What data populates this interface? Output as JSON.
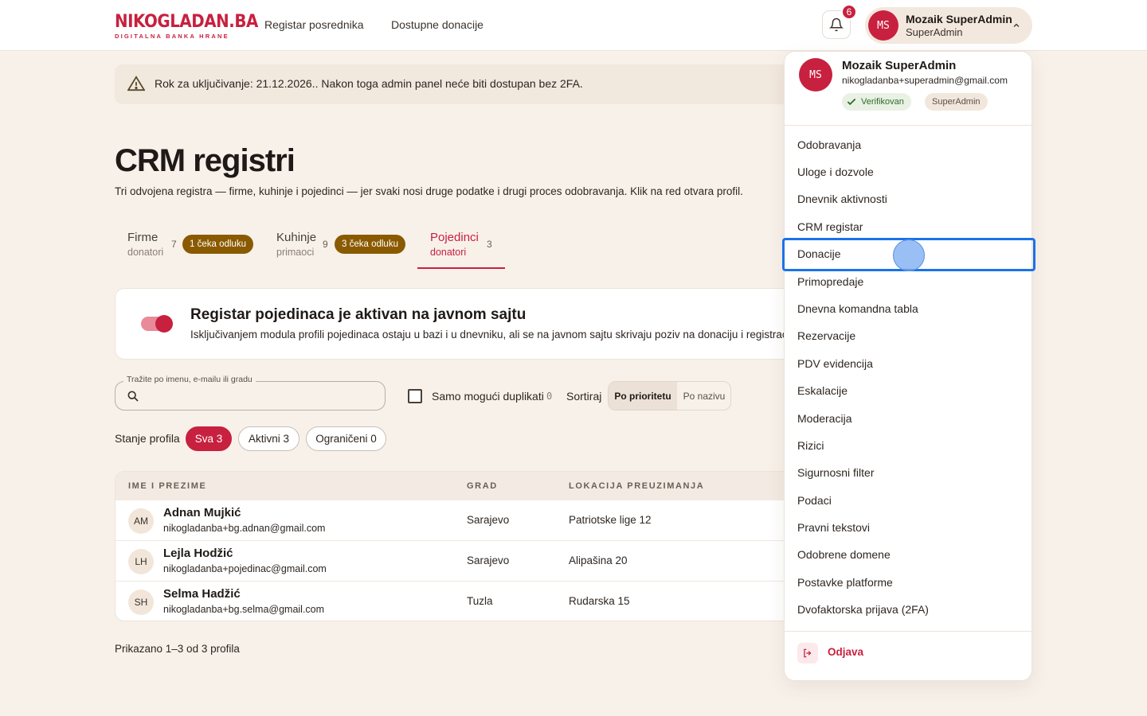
{
  "brand": {
    "name": "NIKOGLADAN.BA",
    "tagline": "DIGITALNA BANKA HRANE"
  },
  "nav": {
    "items": [
      "Registar posrednika",
      "Dostupne donacije"
    ]
  },
  "notifications": {
    "count": "6"
  },
  "user": {
    "initials": "MS",
    "name": "Mozaik SuperAdmin",
    "role": "SuperAdmin",
    "email": "nikogladanba+superadmin@gmail.com",
    "verified_label": "Verifikovan"
  },
  "alert": {
    "text": "Rok za uključivanje: 21.12.2026.. Nakon toga admin panel neće biti dostupan bez 2FA."
  },
  "page": {
    "title": "CRM registri",
    "subtitle": "Tri odvojena registra — firme, kuhinje i pojedinci — jer svaki nosi druge podatke i drugi proces odobravanja. Klik na red otvara profil."
  },
  "tabs": [
    {
      "label": "Firme",
      "sub": "donatori",
      "count": "7",
      "pill": "1 čeka odluku"
    },
    {
      "label": "Kuhinje",
      "sub": "primaoci",
      "count": "9",
      "pill": "3 čeka odluku"
    },
    {
      "label": "Pojedinci",
      "sub": "donatori",
      "count": "3",
      "pill": ""
    }
  ],
  "module": {
    "title": "Registar pojedinaca je aktivan na javnom sajtu",
    "description": "Isključivanjem modula profili pojedinaca ostaju u bazi i u dnevniku, ali se na javnom sajtu skrivaju poziv na donaciju i registraciju."
  },
  "filters": {
    "search_label": "Tražite po imenu, e-mailu ili gradu",
    "search_value": "",
    "duplicates_label": "Samo mogući duplikati",
    "duplicates_count": "0",
    "sort_label": "Sortiraj",
    "sort_options": [
      "Po prioritetu",
      "Po nazivu"
    ],
    "state_label": "Stanje profila",
    "state_chips": [
      "Sva 3",
      "Aktivni 3",
      "Ograničeni 0"
    ]
  },
  "table": {
    "headers": [
      "IME I PREZIME",
      "GRAD",
      "LOKACIJA PREUZIMANJA"
    ],
    "rows": [
      {
        "initials": "AM",
        "name": "Adnan Mujkić",
        "email": "nikogladanba+bg.adnan@gmail.com",
        "city": "Sarajevo",
        "location": "Patriotske lige 12"
      },
      {
        "initials": "LH",
        "name": "Lejla Hodžić",
        "email": "nikogladanba+pojedinac@gmail.com",
        "city": "Sarajevo",
        "location": "Alipašina 20"
      },
      {
        "initials": "SH",
        "name": "Selma Hadžić",
        "email": "nikogladanba+bg.selma@gmail.com",
        "city": "Tuzla",
        "location": "Rudarska 15"
      }
    ]
  },
  "pager": {
    "text": "Prikazano 1–3 od 3 profila"
  },
  "menu": {
    "items": [
      "Odobravanja",
      "Uloge i dozvole",
      "Dnevnik aktivnosti",
      "CRM registar",
      "Donacije",
      "Primopredaje",
      "Dnevna komandna tabla",
      "Rezervacije",
      "PDV evidencija",
      "Eskalacije",
      "Moderacija",
      "Rizici",
      "Sigurnosni filter",
      "Podaci",
      "Pravni tekstovi",
      "Odobrene domene",
      "Postavke platforme",
      "Dvofaktorska prijava (2FA)"
    ],
    "logout": "Odjava"
  },
  "colors": {
    "accent": "#c8203f",
    "pending": "#8a5a00",
    "background": "#f8f1ea",
    "focus": "#1a73e8"
  }
}
